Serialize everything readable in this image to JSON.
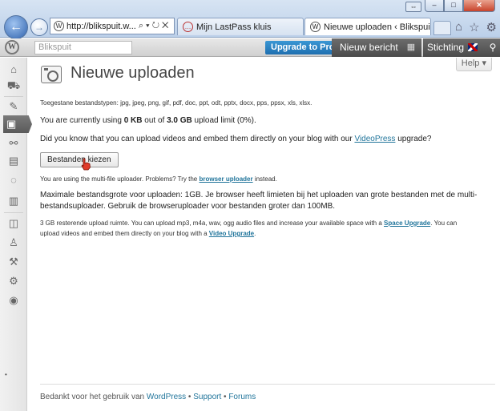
{
  "browser": {
    "address": "http://blikspuit.w...",
    "address_tools": "⌕ ▾ ↻ ✕",
    "tabs": [
      {
        "label": "Mijn LastPass kluis",
        "active": false
      },
      {
        "label": "Nieuwe uploaden ‹ Blikspui...",
        "active": true
      }
    ],
    "tab_close": "✕",
    "window_buttons": {
      "minimize": "–",
      "maximize": "□",
      "close": "✕"
    }
  },
  "adminbar": {
    "blog_name": "Blikspuit",
    "upgrade_label": "Upgrade to Pro",
    "new_post_label": "Nieuw bericht",
    "site_label": "Stichting",
    "colors": {
      "upgrade": "#1f6fb0",
      "dark": "#555555"
    }
  },
  "help_label": "Help ▾",
  "page_title": "Nieuwe uploaden",
  "allowed_types": "Toegestane bestandstypen: jpg, jpeg, png, gif, pdf, doc, ppt, odt, pptx, docx, pps, ppsx, xls, xlsx.",
  "usage": {
    "prefix": "You are currently using ",
    "used": "0 KB",
    "mid": " out of ",
    "limit": "3.0 GB",
    "suffix": " upload limit (0%)."
  },
  "videopress": {
    "prefix": "Did you know that you can upload videos and embed them directly on your blog with our ",
    "link": "VideoPress",
    "suffix": " upgrade?"
  },
  "choose_button": "Bestanden kiezen",
  "multi_file": {
    "prefix": "You are using the multi-file uploader. Problems? Try the ",
    "link": "browser uploader",
    "suffix": " instead."
  },
  "max_size_line1": "Maximale bestandsgrote voor uploaden: 1GB. Je browser heeft limieten bij het uploaden van grote bestanden met de multi-",
  "max_size_line2": "bestandsuploader. Gebruik de browseruploader voor bestanden groter dan 100MB.",
  "space": {
    "prefix": "3 GB resterende upload ruimte. You can upload mp3, m4a, wav, ogg audio files and increase your available space with a ",
    "link1": "Space Upgrade",
    "mid": ". You can",
    "line2_prefix": "upload videos and embed them directly on your blog with a ",
    "link2": "Video Upgrade",
    "line2_suffix": "."
  },
  "footer": {
    "prefix": "Bedankt voor het gebruik van ",
    "wordpress": "WordPress",
    "sep1": " • ",
    "support": "Support",
    "sep2": " • ",
    "forums": "Forums"
  },
  "colors": {
    "link": "#21759b",
    "title": "#464646"
  }
}
